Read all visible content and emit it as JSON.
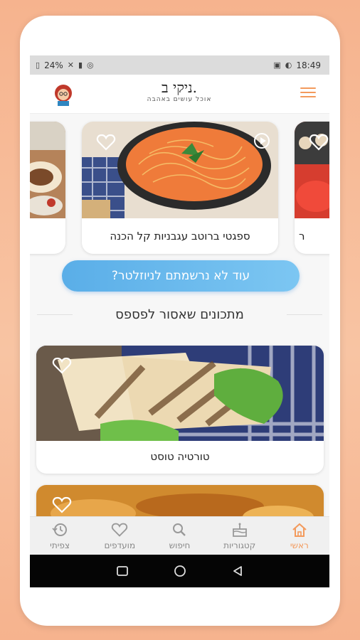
{
  "status_bar": {
    "battery": "24%",
    "time": "18:49"
  },
  "app_bar": {
    "logo_title": "ניקי ב.",
    "logo_subtitle": "אוכל עושים באהבה"
  },
  "carousel": {
    "cards": [
      {
        "title": ""
      },
      {
        "title": "ספגטי ברוטב עגבניות קל הכנה"
      },
      {
        "title": "ר"
      }
    ]
  },
  "newsletter": {
    "label": "עוד לא נרשמתם לניוזלטר?"
  },
  "section": {
    "title": "מתכונים שאסור לפספס"
  },
  "recipes": [
    {
      "title": "טורטיה טוסט"
    },
    {
      "title": ""
    }
  ],
  "bottom_nav": {
    "items": [
      {
        "label": "ראשי",
        "icon": "home-icon",
        "active": true
      },
      {
        "label": "קטגוריות",
        "icon": "cake-icon",
        "active": false
      },
      {
        "label": "חיפוש",
        "icon": "search-icon",
        "active": false
      },
      {
        "label": "מועדפים",
        "icon": "heart-icon",
        "active": false
      },
      {
        "label": "צפיתי",
        "icon": "history-icon",
        "active": false
      }
    ]
  },
  "colors": {
    "accent": "#f39a5c",
    "newsletter_button": "#6bb9ee",
    "background": "#f6b38e"
  }
}
